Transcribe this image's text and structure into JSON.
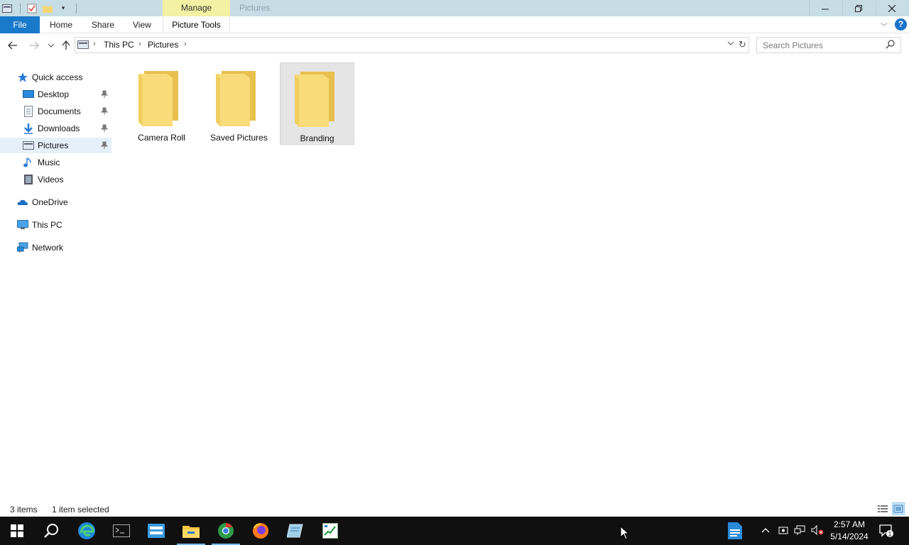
{
  "window": {
    "title": "Pictures",
    "context_tab": "Manage"
  },
  "ribbon": {
    "tabs": [
      "File",
      "Home",
      "Share",
      "View",
      "Picture Tools"
    ]
  },
  "address": {
    "crumbs": [
      "This PC",
      "Pictures"
    ]
  },
  "search": {
    "placeholder": "Search Pictures"
  },
  "sidebar": {
    "items": [
      {
        "label": "Quick access",
        "icon": "star-icon"
      },
      {
        "label": "Desktop",
        "icon": "desktop-icon",
        "pinned": true
      },
      {
        "label": "Documents",
        "icon": "documents-icon",
        "pinned": true
      },
      {
        "label": "Downloads",
        "icon": "downloads-icon",
        "pinned": true
      },
      {
        "label": "Pictures",
        "icon": "pictures-icon",
        "pinned": true,
        "selected": true
      },
      {
        "label": "Music",
        "icon": "music-icon"
      },
      {
        "label": "Videos",
        "icon": "videos-icon"
      },
      {
        "label": "OneDrive",
        "icon": "onedrive-icon"
      },
      {
        "label": "This PC",
        "icon": "this-pc-icon"
      },
      {
        "label": "Network",
        "icon": "network-icon"
      }
    ]
  },
  "content": {
    "folders": [
      {
        "name": "Camera Roll",
        "selected": false
      },
      {
        "name": "Saved Pictures",
        "selected": false
      },
      {
        "name": "Branding",
        "selected": true
      }
    ]
  },
  "status": {
    "item_count": "3 items",
    "selection": "1 item selected"
  },
  "taskbar": {
    "apps": [
      "start",
      "search",
      "edge",
      "terminal",
      "server-manager",
      "file-explorer",
      "chrome",
      "firefox",
      "notepad",
      "task-manager"
    ],
    "time": "2:57 AM",
    "date": "5/14/2024",
    "notification_count": "1"
  },
  "colors": {
    "titlebar": "#c6dde5",
    "manage_tab": "#f3f1a3",
    "file_tab": "#1979ca",
    "selection": "#e5f0fa",
    "taskbar": "#101010"
  }
}
